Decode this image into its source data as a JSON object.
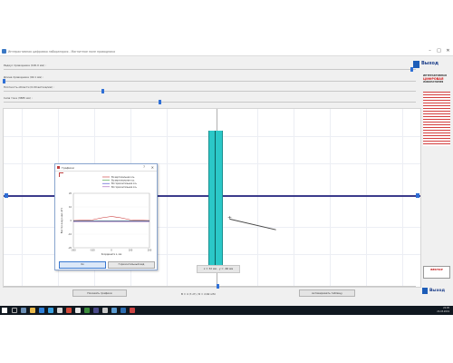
{
  "window": {
    "title": "Интерактивная цифровая лаборатория - Магнитное поле проводника",
    "min": "–",
    "max": "□",
    "close": "✕"
  },
  "params": [
    {
      "label": "Радиус проводника (100.0 мм) :",
      "value_pct": 99
    },
    {
      "label": "Длина проводника (40.1 мм) :",
      "value_pct": 0
    },
    {
      "label": "Плотность области (0.00 витков/мм) :",
      "value_pct": 24
    },
    {
      "label": "Сила тока (3885 мА) :",
      "value_pct": 38
    }
  ],
  "header_logo": {
    "text": "Выход"
  },
  "side": {
    "lab_line1": "ИНТЕРАКТИВНАЯ",
    "lab_line2": "ЦИФРОВАЯ",
    "lab_line3": "ЛАБОРАТОРИЯ",
    "sponsor": "ВЕКТОР",
    "exit": "Выход"
  },
  "plot": {
    "coord": "x = 32 мм ,  y = -66 мм"
  },
  "dialog": {
    "title": "Графики",
    "help": "?",
    "close": "✕",
    "ok": "Ок",
    "alt": "Горизонтальный вид",
    "legend": [
      {
        "name": "Bx вертикальная ось",
        "color": "#c83232"
      },
      {
        "name": "By вертикальная ось",
        "color": "#3c9c3c"
      },
      {
        "name": "Bz горизонтальная ось",
        "color": "#3c3cc8"
      },
      {
        "name": "Bz горизонтальная ось",
        "color": "#9c5ab4"
      }
    ],
    "ylabel": "Вектор индукции, мТл",
    "xlabel": "Координата х, мм",
    "yticks": [
      "20",
      "10",
      "0",
      "-10",
      "-20"
    ],
    "xticks": [
      "-200",
      "-100",
      "0",
      "100",
      "200"
    ]
  },
  "chart_data": {
    "type": "line",
    "x": [
      -200,
      -100,
      -50,
      0,
      50,
      100,
      200
    ],
    "series": [
      {
        "name": "Bx вертикальная ось",
        "values": [
          0,
          0.5,
          2,
          3,
          2,
          0.5,
          0
        ]
      },
      {
        "name": "By вертикальная ось",
        "values": [
          0,
          0,
          0,
          0,
          0,
          0,
          0
        ]
      },
      {
        "name": "Bz горизонтальная ось",
        "values": [
          0,
          0,
          0,
          0,
          0,
          0,
          0
        ]
      },
      {
        "name": "Bz горизонтальная ось",
        "values": [
          0,
          0,
          0,
          0,
          0,
          0,
          0
        ]
      }
    ],
    "xlim": [
      -200,
      200
    ],
    "ylim": [
      -20,
      20
    ],
    "xlabel": "Координата х, мм",
    "ylabel": "Вектор индукции, мТл"
  },
  "footer": {
    "btn_graphs": "Показать графики",
    "formula": "B = 4 (?∙I?) / R ≈ 2,62 мТл",
    "btn_table": "Активировать таблицу",
    "slider_pct": 52
  },
  "taskbar": {
    "time": "22:05",
    "date": "24.03.2019"
  }
}
